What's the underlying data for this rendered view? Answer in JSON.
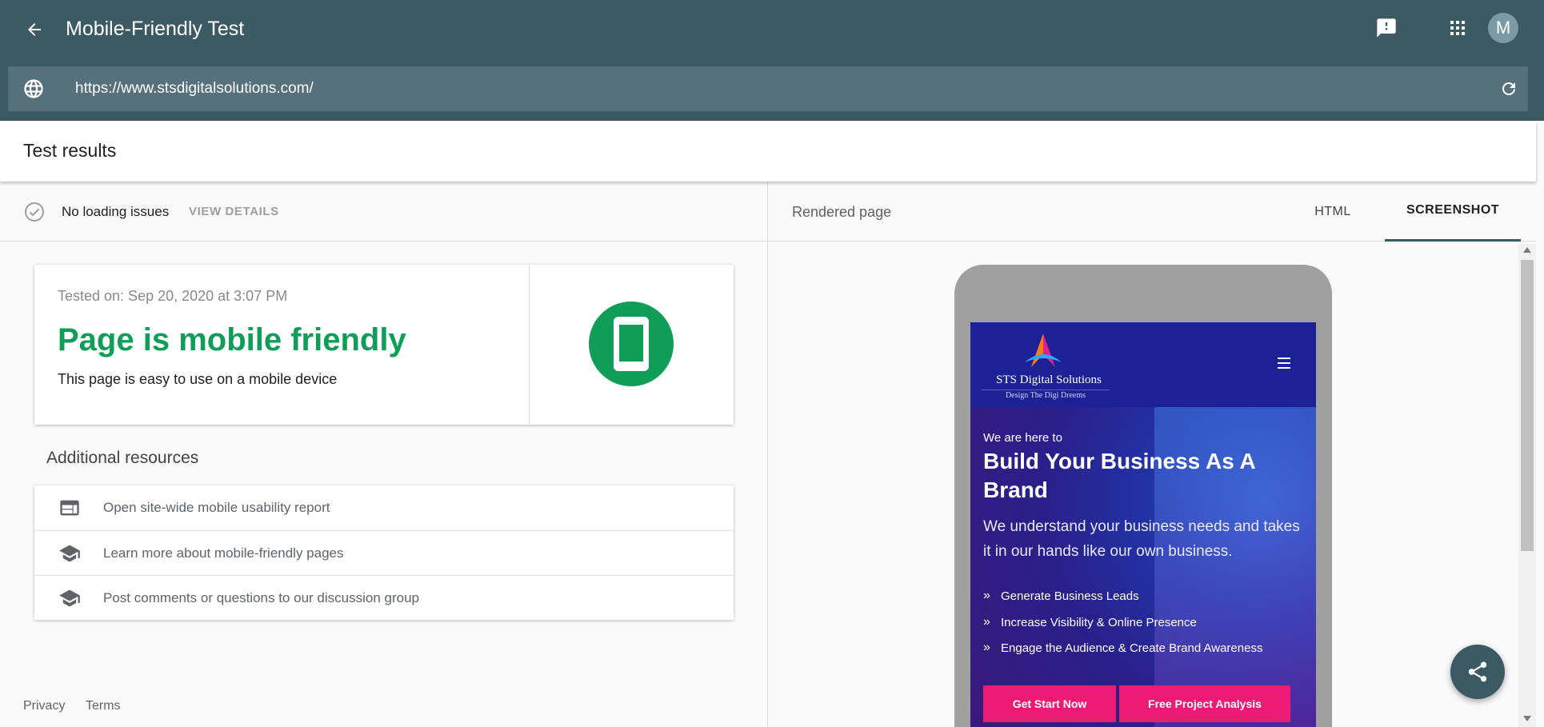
{
  "header": {
    "title": "Mobile-Friendly Test",
    "avatar_initial": "M",
    "url_value": "https://www.stsdigitalsolutions.com/"
  },
  "results": {
    "title": "Test results",
    "status_text": "No loading issues",
    "view_details": "VIEW DETAILS",
    "tested_on": "Tested on: Sep 20, 2020 at 3:07 PM",
    "verdict": "Page is mobile friendly",
    "verdict_sub": "This page is easy to use on a mobile device",
    "resources_heading": "Additional resources",
    "resources": [
      {
        "label": "Open site-wide mobile usability report",
        "icon": "web-page-icon"
      },
      {
        "label": "Learn more about mobile-friendly pages",
        "icon": "school-icon"
      },
      {
        "label": "Post comments or questions to our discussion group",
        "icon": "school-icon"
      }
    ]
  },
  "footer": {
    "privacy": "Privacy",
    "terms": "Terms"
  },
  "rendered": {
    "title": "Rendered page",
    "tabs": [
      "HTML",
      "SCREENSHOT"
    ],
    "active_tab": "SCREENSHOT"
  },
  "site": {
    "logo_name": "STS Digital Solutions",
    "logo_tag": "Design The Digi Dreems",
    "hero_pre": "We are here to",
    "hero_title": "Build Your Business As A Brand",
    "hero_desc": "We understand your business needs and takes it in our hands like our own business.",
    "features": [
      "Generate Business Leads",
      "Increase Visibility & Online Presence",
      "Engage the Audience & Create Brand Awareness"
    ],
    "button_primary": "Get Start Now",
    "button_secondary": "Free Project Analysis"
  },
  "colors": {
    "header_bg": "#3c5a64",
    "urlbar_bg": "#56717b",
    "success_green": "#0f9d58",
    "site_nav": "#1c2196",
    "site_button": "#ee1b74"
  }
}
